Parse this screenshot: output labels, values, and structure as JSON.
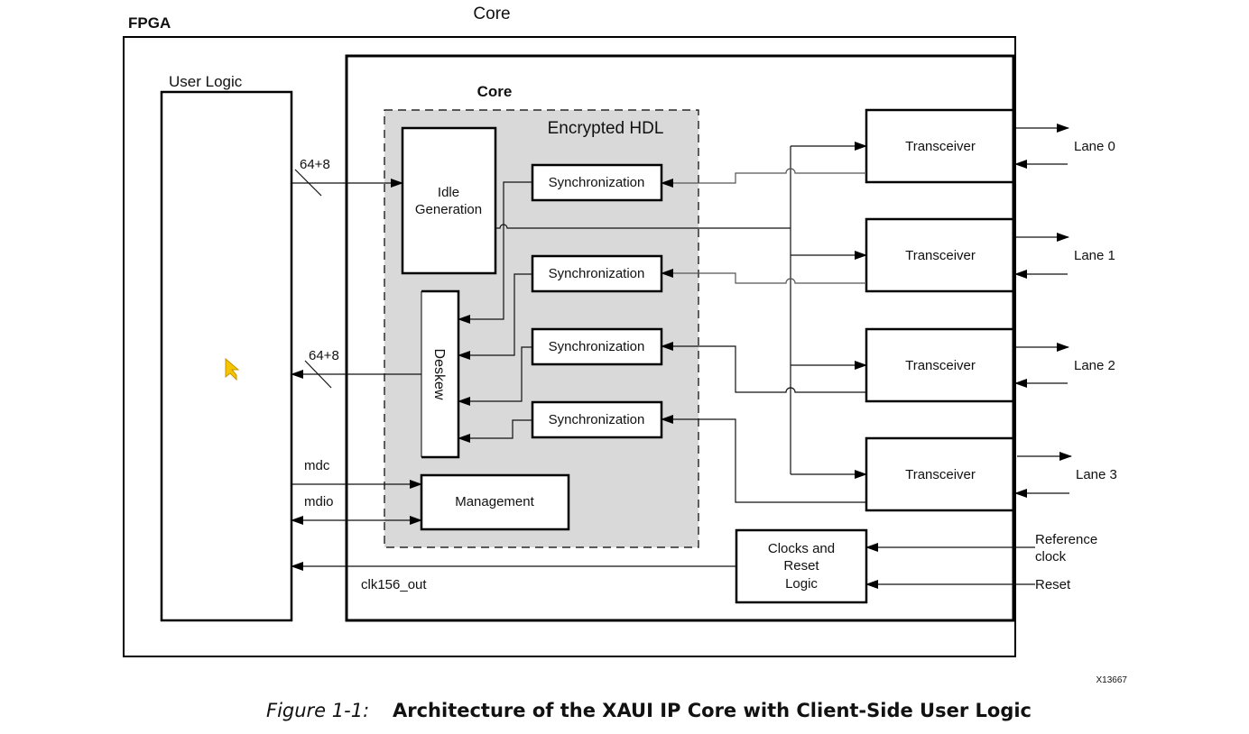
{
  "diagram": {
    "top_label": "Core",
    "fpga_label": "FPGA",
    "user_logic_label": "User Logic",
    "core_label": "Core",
    "encrypted_hdl_label": "Encrypted HDL",
    "idle_generation": [
      "Idle",
      "Generation"
    ],
    "synchronization_blocks": [
      "Synchronization",
      "Synchronization",
      "Synchronization",
      "Synchronization"
    ],
    "deskew_label": "Deskew",
    "management_label": "Management",
    "clocks_reset_logic": [
      "Clocks and",
      "Reset",
      "Logic"
    ],
    "transceivers": [
      "Transceiver",
      "Transceiver",
      "Transceiver",
      "Transceiver"
    ],
    "lanes": [
      "Lane 0",
      "Lane 1",
      "Lane 2",
      "Lane 3"
    ],
    "bus_width_tx": "64+8",
    "bus_width_rx": "64+8",
    "signals": {
      "mdc": "mdc",
      "mdio": "mdio",
      "clk_out": "clk156_out",
      "reference_clock": [
        "Reference",
        "clock"
      ],
      "reset": "Reset"
    },
    "figure_id": "X13667",
    "cursor_icon": "mouse-pointer-icon"
  },
  "caption": {
    "number": "Figure 1-1:",
    "title": "Architecture of the XAUI IP Core with Client-Side User Logic"
  }
}
